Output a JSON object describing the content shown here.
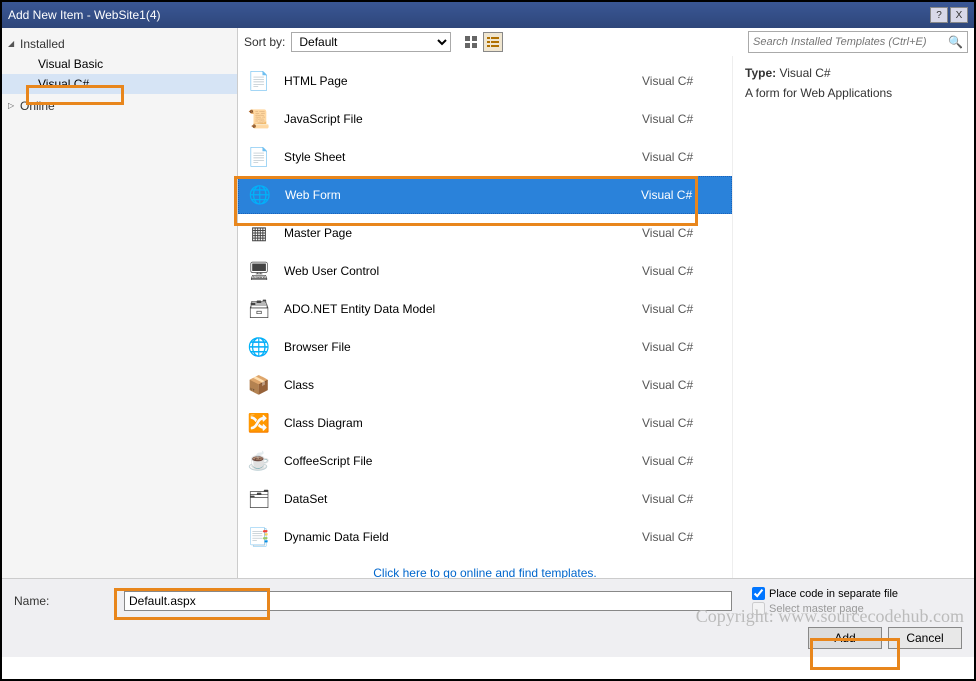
{
  "window": {
    "title": "Add New Item - WebSite1(4)",
    "help": "?",
    "close": "X"
  },
  "sidebar": {
    "installed": "Installed",
    "items": [
      "Visual Basic",
      "Visual C#"
    ],
    "online": "Online"
  },
  "sort": {
    "label": "Sort by:",
    "value": "Default"
  },
  "search": {
    "placeholder": "Search Installed Templates (Ctrl+E)"
  },
  "items": [
    {
      "name": "HTML Page",
      "lang": "Visual C#",
      "icon": "📄"
    },
    {
      "name": "JavaScript File",
      "lang": "Visual C#",
      "icon": "📜"
    },
    {
      "name": "Style Sheet",
      "lang": "Visual C#",
      "icon": "📄"
    },
    {
      "name": "Web Form",
      "lang": "Visual C#",
      "icon": "🌐"
    },
    {
      "name": "Master Page",
      "lang": "Visual C#",
      "icon": "▦"
    },
    {
      "name": "Web User Control",
      "lang": "Visual C#",
      "icon": "🖥"
    },
    {
      "name": "ADO.NET Entity Data Model",
      "lang": "Visual C#",
      "icon": "🗃"
    },
    {
      "name": "Browser File",
      "lang": "Visual C#",
      "icon": "🌐"
    },
    {
      "name": "Class",
      "lang": "Visual C#",
      "icon": "📦"
    },
    {
      "name": "Class Diagram",
      "lang": "Visual C#",
      "icon": "🔀"
    },
    {
      "name": "CoffeeScript File",
      "lang": "Visual C#",
      "icon": "☕"
    },
    {
      "name": "DataSet",
      "lang": "Visual C#",
      "icon": "🗂"
    },
    {
      "name": "Dynamic Data Field",
      "lang": "Visual C#",
      "icon": "📑"
    }
  ],
  "selected_index": 3,
  "online_link": "Click here to go online and find templates.",
  "detail": {
    "type_label": "Type:",
    "type_value": "Visual C#",
    "desc": "A form for Web Applications"
  },
  "bottom": {
    "name_label": "Name:",
    "name_value": "Default.aspx",
    "opt1": "Place code in separate file",
    "opt2": "Select master page",
    "add": "Add",
    "cancel": "Cancel"
  },
  "watermark": "Copyright: www.sourcecodehub.com"
}
